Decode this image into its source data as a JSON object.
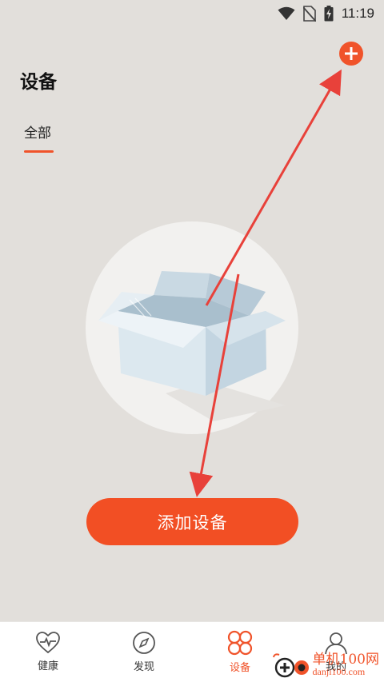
{
  "status_bar": {
    "time": "11:19",
    "icons": [
      "wifi-icon",
      "no-sim-icon",
      "battery-charging-icon"
    ]
  },
  "header": {
    "title": "设备",
    "add_icon": "plus-circle-icon"
  },
  "tabs": [
    {
      "label": "全部",
      "active": true
    }
  ],
  "empty_state": {
    "illustration": "empty-box-icon"
  },
  "primary_button": {
    "label": "添加设备"
  },
  "bottom_nav": {
    "items": [
      {
        "label": "健康",
        "icon": "heartbeat-icon",
        "active": false
      },
      {
        "label": "发现",
        "icon": "compass-icon",
        "active": false
      },
      {
        "label": "设备",
        "icon": "device-clover-icon",
        "active": true
      },
      {
        "label": "我的",
        "icon": "user-icon",
        "active": false
      }
    ]
  },
  "watermark": {
    "main": "单机100网",
    "sub": "danji100.com"
  },
  "colors": {
    "accent": "#f0532a",
    "background": "#e2dfdb",
    "annotation_arrow": "#e8413a"
  }
}
